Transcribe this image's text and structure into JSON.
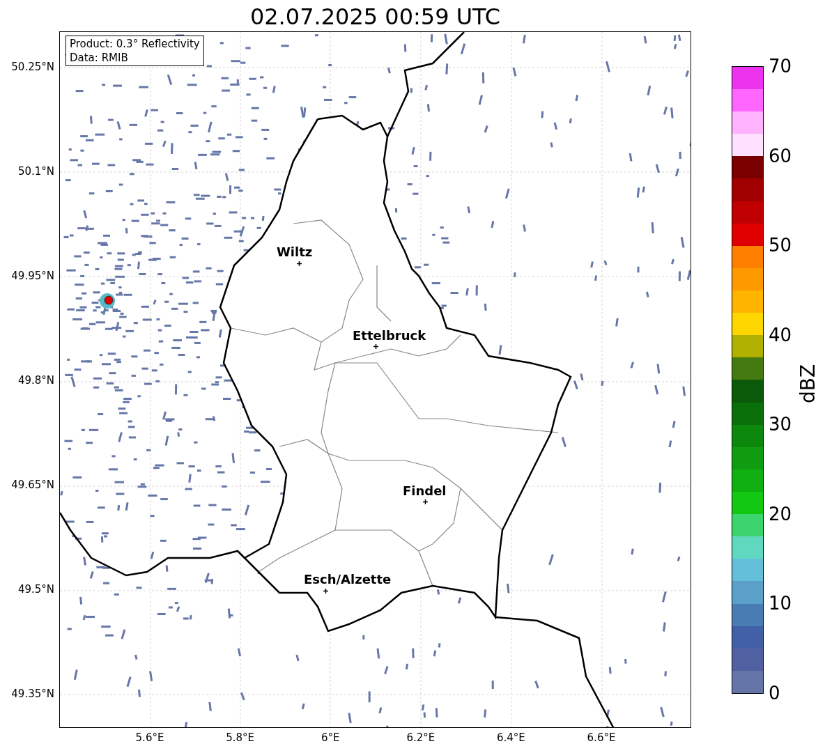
{
  "title": "02.07.2025 00:59 UTC",
  "info_box": {
    "lines": [
      "Product: 0.3° Reflectivity",
      "Data: RMIB"
    ]
  },
  "y_ticks": [
    "50.25°N",
    "50.1°N",
    "49.95°N",
    "49.8°N",
    "49.65°N",
    "49.5°N",
    "49.35°N"
  ],
  "x_ticks": [
    "5.6°E",
    "5.8°E",
    "6°E",
    "6.2°E",
    "6.4°E",
    "6.6°E"
  ],
  "places": [
    {
      "name": "Wiltz"
    },
    {
      "name": "Ettelbruck"
    },
    {
      "name": "Findel"
    },
    {
      "name": "Esch/Alzette"
    }
  ],
  "colorbar": {
    "label": "dBZ",
    "ticks": [
      "70",
      "60",
      "50",
      "40",
      "30",
      "20",
      "10",
      "0"
    ],
    "bands": [
      {
        "color": "#6675a8"
      },
      {
        "color": "#5060a0"
      },
      {
        "color": "#4260a8"
      },
      {
        "color": "#4a7cb4"
      },
      {
        "color": "#5aa0c8"
      },
      {
        "color": "#64c0d8"
      },
      {
        "color": "#60d8c0"
      },
      {
        "color": "#3cd46c"
      },
      {
        "color": "#12c812"
      },
      {
        "color": "#10b010"
      },
      {
        "color": "#109c10"
      },
      {
        "color": "#0c880c"
      },
      {
        "color": "#0a700a"
      },
      {
        "color": "#0a5a0a"
      },
      {
        "color": "#457a10"
      },
      {
        "color": "#b0b000"
      },
      {
        "color": "#ffd700"
      },
      {
        "color": "#ffb400"
      },
      {
        "color": "#ff9900"
      },
      {
        "color": "#ff7f00"
      },
      {
        "color": "#e00000"
      },
      {
        "color": "#c00000"
      },
      {
        "color": "#a00000"
      },
      {
        "color": "#7a0000"
      },
      {
        "color": "#ffe0ff"
      },
      {
        "color": "#ffb3ff"
      },
      {
        "color": "#ff66ff"
      },
      {
        "color": "#ee33ee"
      }
    ]
  }
}
